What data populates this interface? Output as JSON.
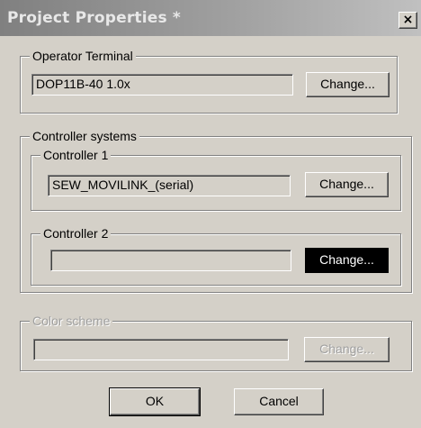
{
  "window": {
    "title": "Project Properties *",
    "close_glyph": "×"
  },
  "operator_terminal": {
    "legend": "Operator Terminal",
    "value": "DOP11B-40 1.0x",
    "change_label": "Change..."
  },
  "controller_systems": {
    "legend": "Controller systems",
    "controller1": {
      "legend": "Controller 1",
      "value": "SEW_MOVILINK_(serial)",
      "change_label": "Change..."
    },
    "controller2": {
      "legend": "Controller 2",
      "value": "",
      "change_label": "Change..."
    }
  },
  "color_scheme": {
    "legend": "Color scheme",
    "value": "",
    "change_label": "Change..."
  },
  "footer": {
    "ok_label": "OK",
    "cancel_label": "Cancel"
  }
}
